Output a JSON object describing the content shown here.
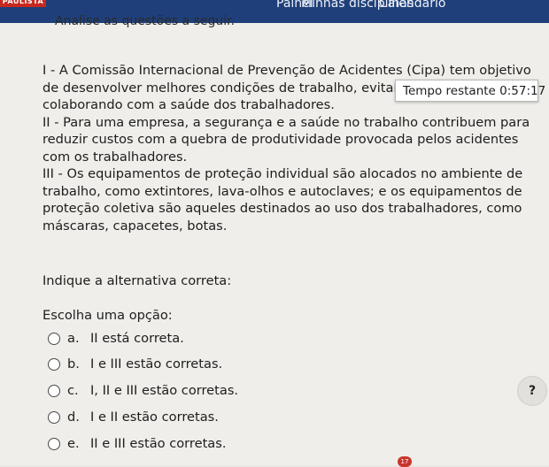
{
  "header": {
    "brand": "PAULISTA",
    "nav": [
      {
        "label": "Painel"
      },
      {
        "label": "Minhas disciplinas"
      },
      {
        "label": "Calendário"
      }
    ]
  },
  "question": {
    "intro": "Analise as questões a seguir.",
    "statements": [
      "I - A Comissão Internacional de Prevenção de Acidentes (Cipa) tem objetivo de desenvolver melhores condições de trabalho, evitando acidentes e colaborando com a saúde dos trabalhadores.",
      "II - Para uma empresa, a segurança e a saúde no trabalho contribuem para reduzir custos com a quebra de produtividade provocada pelos acidentes com os trabalhadores.",
      "III - Os equipamentos de proteção individual são alocados no ambiente de trabalho, como extintores, lava-olhos e autoclaves; e os equipamentos de proteção coletiva são aqueles destinados ao uso dos trabalhadores, como máscaras, capacetes, botas."
    ],
    "prompt": "Indique a alternativa correta:",
    "choose_label": "Escolha uma opção:",
    "options": [
      {
        "letter": "a.",
        "text": "II está correta."
      },
      {
        "letter": "b.",
        "text": "I e III estão corretas."
      },
      {
        "letter": "c.",
        "text": "I, II e III estão corretas."
      },
      {
        "letter": "d.",
        "text": "I e II estão corretas."
      },
      {
        "letter": "e.",
        "text": "II e III estão corretas."
      }
    ]
  },
  "timer": {
    "label": "Tempo restante",
    "value": "0:57:17"
  },
  "help": {
    "label": "?"
  },
  "badge": {
    "count": "17"
  }
}
